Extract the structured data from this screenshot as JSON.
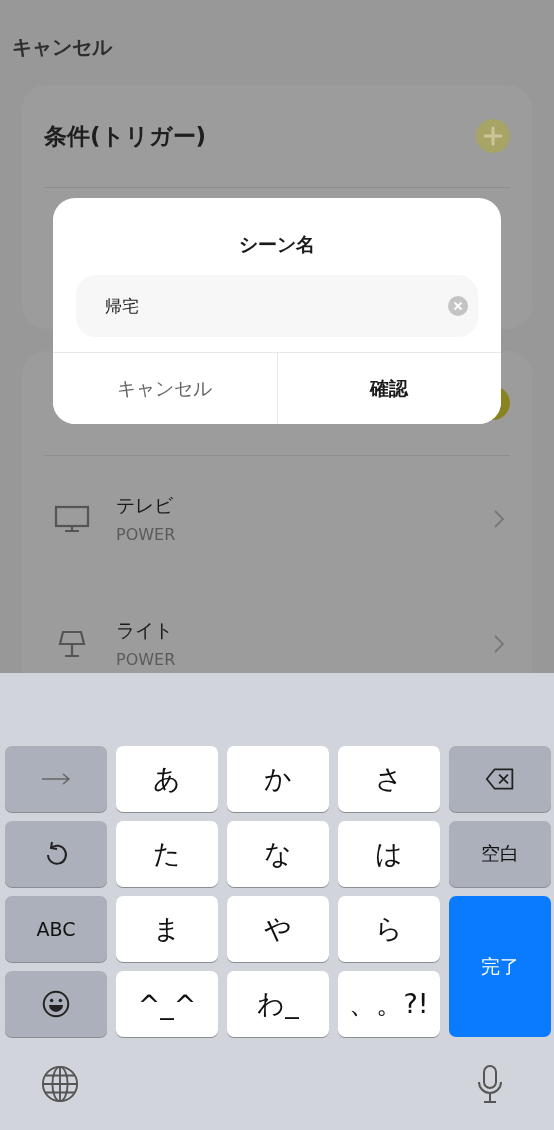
{
  "background": {
    "cancel_label": "キャンセル",
    "trigger_section": {
      "title": "条件(トリガー)"
    },
    "action_section": {
      "devices": [
        {
          "name": "テレビ",
          "command": "POWER",
          "kind": "tv"
        },
        {
          "name": "ライト",
          "command": "POWER",
          "kind": "lamp"
        }
      ]
    }
  },
  "dialog": {
    "title": "シーン名",
    "field": {
      "value": "帰宅"
    },
    "buttons": [
      {
        "label": "キャンセル",
        "kind": "cancel"
      },
      {
        "label": "確認",
        "kind": "confirm"
      }
    ]
  },
  "keyboard": {
    "keys": [
      {
        "kind": "arrow"
      },
      {
        "kind": "kana",
        "label": "あ"
      },
      {
        "kind": "kana",
        "label": "か"
      },
      {
        "kind": "kana",
        "label": "さ"
      },
      {
        "kind": "delete"
      },
      {
        "kind": "undo"
      },
      {
        "kind": "kana",
        "label": "た"
      },
      {
        "kind": "kana",
        "label": "な"
      },
      {
        "kind": "kana",
        "label": "は"
      },
      {
        "kind": "space",
        "label": "空白"
      },
      {
        "kind": "abc",
        "label": "ABC"
      },
      {
        "kind": "kana",
        "label": "ま"
      },
      {
        "kind": "kana",
        "label": "や"
      },
      {
        "kind": "kana",
        "label": "ら"
      },
      {
        "kind": "done",
        "label": "完了"
      },
      {
        "kind": "emoji"
      },
      {
        "kind": "kana",
        "label": "^_^"
      },
      {
        "kind": "kana",
        "label": "わ_"
      },
      {
        "kind": "kana",
        "label": "、。?!"
      }
    ]
  }
}
